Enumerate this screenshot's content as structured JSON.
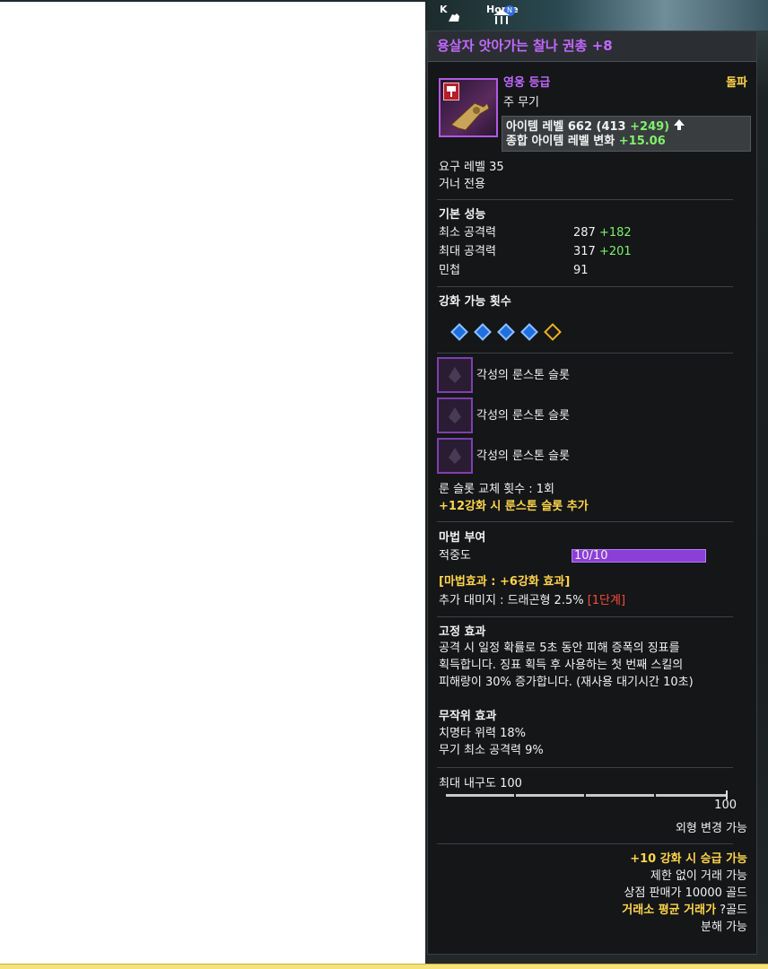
{
  "hud": {
    "k_key": "K",
    "home_key": "Home",
    "home_badge": "N"
  },
  "item": {
    "name": "용살자 앗아가는 찰나 권총 +8",
    "grade": "영웅 등급",
    "breakthrough": "돌파",
    "type": "주 무기",
    "item_level_label": "아이템 레벨 662 (413",
    "item_level_bonus": "+249)",
    "total_level_change_label": "종합 아이템 레벨 변화",
    "total_level_change_value": "+15.06",
    "required_level": "요구 레벨 35",
    "class_only": "거너 전용"
  },
  "basic_stats": {
    "header": "기본 성능",
    "rows": [
      {
        "label": "최소 공격력",
        "value": "287",
        "bonus": "+182"
      },
      {
        "label": "최대 공격력",
        "value": "317",
        "bonus": "+201"
      },
      {
        "label": "민첩",
        "value": "91",
        "bonus": ""
      }
    ]
  },
  "enhance": {
    "header": "강화 가능 횟수",
    "filled": 4,
    "total": 5
  },
  "runes": {
    "slots": [
      "각성의 룬스톤 슬롯",
      "각성의 룬스톤 슬롯",
      "각성의 룬스톤 슬롯"
    ],
    "swap_count": "룬 슬롯 교체 횟수 : 1회",
    "bonus_note": "+12강화 시 룬스톤 슬롯 추가"
  },
  "magic": {
    "header": "마법 부여",
    "precision_label": "적중도",
    "precision_value": "10/10",
    "precision_fraction": 1.0,
    "effect_title": "[마법효과 : +6강화 효과]",
    "effect_text": "추가 대미지 : 드래곤형 2.5%",
    "effect_stage": "[1단계]"
  },
  "fixed_effect": {
    "header": "고정 효과",
    "lines": [
      "공격 시 일정 확률로 5초 동안 피해 증폭의 징표를",
      "획득합니다. 징표 획득 후 사용하는 첫 번째 스킬의",
      "피해량이 30% 증가합니다. (재사용 대기시간 10초)"
    ]
  },
  "random_effect": {
    "header": "무작위 효과",
    "lines": [
      "치명타 위력 18%",
      "무기 최소 공격력 9%"
    ]
  },
  "durability": {
    "label": "최대 내구도 100",
    "value": "100"
  },
  "footer": {
    "appearance": "외형 변경 가능",
    "upgrade": "+10 강화 시 승급 가능",
    "trade": "제한 없이 거래 가능",
    "shop_price": "상점 판매가 10000 골드",
    "market_price_label": "거래소 평균 거래가",
    "market_price_value": "?골드",
    "dismantle": "분해 가능"
  },
  "colors": {
    "grade_purple": "#c268ff",
    "bonus_green": "#7ff06b",
    "highlight_yellow": "#ffd54a",
    "stage_red": "#ff4a3a"
  }
}
